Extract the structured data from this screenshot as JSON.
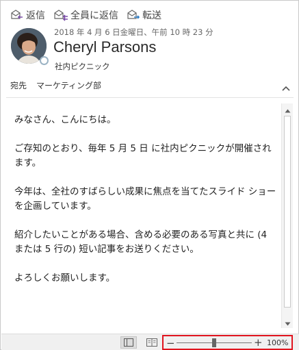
{
  "actions": {
    "reply_label": "返信",
    "reply_all_label": "全員に返信",
    "forward_label": "転送"
  },
  "message": {
    "date": "2018 年 4 月 6 日金曜日、午前 10 時 23 分",
    "sender": "Cheryl Parsons",
    "subject": "社内ピクニック",
    "to_label": "宛先",
    "to_value": "マーケティング部",
    "body": [
      "みなさん、こんにちは。",
      "ご存知のとおり、毎年 5 月 5 日 に社内ピクニックが開催されます。",
      "今年は、全社のすばらしい成果に焦点を当てたスライド ショーを企画しています。",
      "紹介したいことがある場合、含める必要のある写真と共に (4 または 5 行の) 短い記事をお送りください。",
      "よろしくお願いします。"
    ]
  },
  "statusbar": {
    "zoom_percent": 100,
    "zoom_label": "100%",
    "zoom_slider_fraction": 0.5
  },
  "colors": {
    "highlight_border": "#e0141e",
    "arrow_blue": "#2e7cc4",
    "arrow_purple": "#7b4fa8"
  },
  "icons": {
    "reply": "reply-icon",
    "reply_all": "reply-all-icon",
    "forward": "forward-icon",
    "collapse": "chevron-up-icon",
    "presence": "presence-status-icon"
  }
}
